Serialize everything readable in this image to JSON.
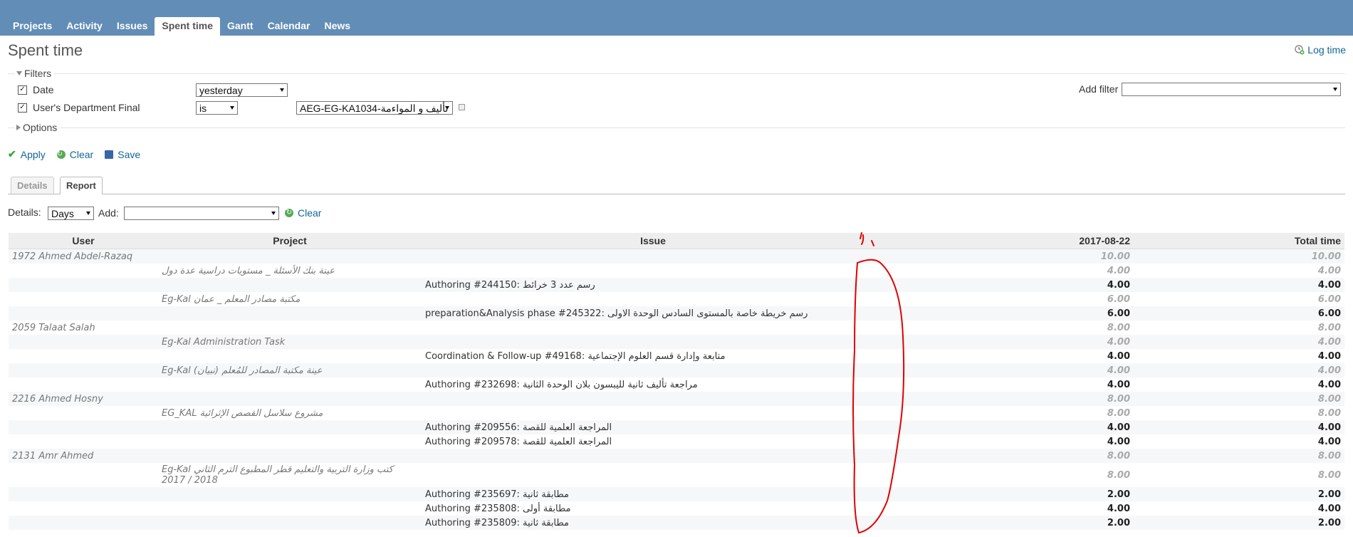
{
  "nav": {
    "tabs": [
      {
        "label": "Projects"
      },
      {
        "label": "Activity"
      },
      {
        "label": "Issues"
      },
      {
        "label": "Spent time"
      },
      {
        "label": "Gantt"
      },
      {
        "label": "Calendar"
      },
      {
        "label": "News"
      }
    ],
    "selected": "Spent time"
  },
  "page": {
    "title": "Spent time",
    "log_time": "Log time"
  },
  "filters": {
    "legend": "Filters",
    "date_label": "Date",
    "date_value": "yesterday",
    "dept_label": "User's Department Final",
    "dept_operator": "is",
    "dept_value": "AEG-EG-KA1034-تأليف و المواءمة",
    "add_filter_label": "Add filter",
    "add_filter_value": ""
  },
  "options": {
    "legend": "Options"
  },
  "actions": {
    "apply": "Apply",
    "clear": "Clear",
    "save": "Save"
  },
  "report_tabs": {
    "details": "Details",
    "report": "Report"
  },
  "details_bar": {
    "details_label": "Details:",
    "details_value": "Days",
    "add_label": "Add:",
    "add_value": "",
    "clear": "Clear"
  },
  "table": {
    "headers": {
      "user": "User",
      "project": "Project",
      "issue": "Issue",
      "date": "2017-08-22",
      "total": "Total time"
    },
    "rows": [
      {
        "level": 0,
        "text": "1972 Ahmed Abdel-Razaq",
        "date": "10.00",
        "total": "10.00"
      },
      {
        "level": 1,
        "text": "عينة بنك الأسئلة _ مستويات دراسية عدة دول",
        "date": "4.00",
        "total": "4.00"
      },
      {
        "level": 2,
        "text": "Authoring #244150: رسم عدد 3 خرائط",
        "date": "4.00",
        "total": "4.00"
      },
      {
        "level": 1,
        "text": "Eg-Kal مكتبة مصادر المعلم _ عمان",
        "date": "6.00",
        "total": "6.00"
      },
      {
        "level": 2,
        "text": "preparation&Analysis phase #245322: رسم خريطة خاصة بالمستوى السادس الوحدة الاولى",
        "date": "6.00",
        "total": "6.00"
      },
      {
        "level": 0,
        "text": "2059 Talaat Salah",
        "date": "8.00",
        "total": "8.00"
      },
      {
        "level": 1,
        "text": "Eg-Kal Administration Task",
        "date": "4.00",
        "total": "4.00"
      },
      {
        "level": 2,
        "text": "Coordination & Follow-up #49168: متابعة وإدارة قسم العلوم الإجتماعية",
        "date": "4.00",
        "total": "4.00"
      },
      {
        "level": 1,
        "text": "Eg-Kal (نبيان) عينة مكتبة المصادر للمُعلم",
        "date": "4.00",
        "total": "4.00"
      },
      {
        "level": 2,
        "text": "Authoring #232698: مراجعة تأليف ثانية لليبسون بلان الوحدة الثانية",
        "date": "4.00",
        "total": "4.00"
      },
      {
        "level": 0,
        "text": "2216 Ahmed Hosny",
        "date": "8.00",
        "total": "8.00"
      },
      {
        "level": 1,
        "text": "EG_KAL مشروع سلاسل القصص الإثرائية",
        "date": "8.00",
        "total": "8.00"
      },
      {
        "level": 2,
        "text": "Authoring #209556: المراجعة العلمية للقصة",
        "date": "4.00",
        "total": "4.00"
      },
      {
        "level": 2,
        "text": "Authoring #209578: المراجعة العلمية للقصة",
        "date": "4.00",
        "total": "4.00"
      },
      {
        "level": 0,
        "text": "2131 Amr Ahmed",
        "date": "8.00",
        "total": "8.00"
      },
      {
        "level": 1,
        "text": "Eg-Kal كتب وزارة التربية والتعليم قطر المطبوع الترم الثاني 2018 / 2017",
        "date": "8.00",
        "total": "8.00",
        "tall": true
      },
      {
        "level": 2,
        "text": "Authoring #235697: مطابقة ثانية",
        "date": "2.00",
        "total": "2.00"
      },
      {
        "level": 2,
        "text": "Authoring #235808: مطابقة أولى",
        "date": "4.00",
        "total": "4.00"
      },
      {
        "level": 2,
        "text": "Authoring #235809: مطابقة ثانية",
        "date": "2.00",
        "total": "2.00"
      }
    ]
  },
  "colors": {
    "header_bar": "#628db6",
    "link": "#116699",
    "annotation": "#e00000"
  }
}
